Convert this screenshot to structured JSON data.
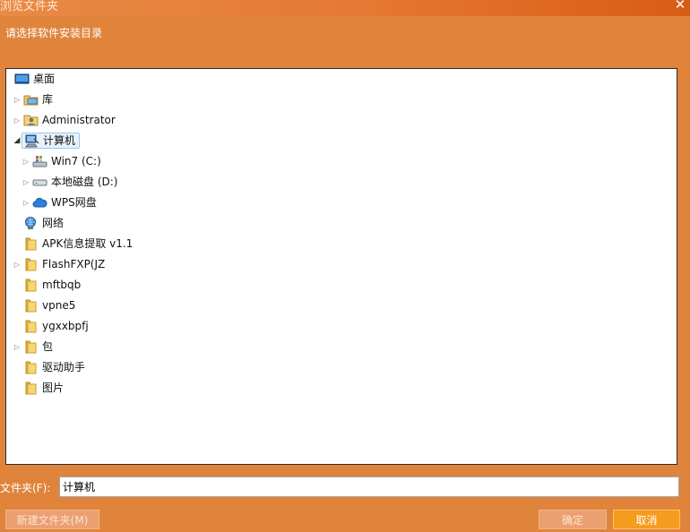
{
  "window": {
    "title": "浏览文件夹",
    "close_label": "✕"
  },
  "prompt": "请选择软件安装目录",
  "tree": {
    "desktop": "桌面",
    "libraries": "库",
    "administrator": "Administrator",
    "computer": "计算机",
    "drive_c": "Win7 (C:)",
    "drive_d": "本地磁盘 (D:)",
    "wps_cloud": "WPS网盘",
    "network": "网络",
    "apk": "APK信息提取 v1.1",
    "flashfxp": "FlashFXP(JZ",
    "mftbqb": "mftbqb",
    "vpne5": "vpne5",
    "ygxxbpfj": "ygxxbpfj",
    "bao": "包",
    "driver_helper": "驱动助手",
    "pictures": "图片"
  },
  "folder_field": {
    "label": "文件夹(F):",
    "value": "计算机"
  },
  "buttons": {
    "new_folder": "新建文件夹(M)",
    "ok": "确定",
    "cancel": "取消"
  },
  "colors": {
    "background": "#e0843c",
    "selection": "#e8f2fc",
    "cancel_button": "#f59b1e"
  }
}
